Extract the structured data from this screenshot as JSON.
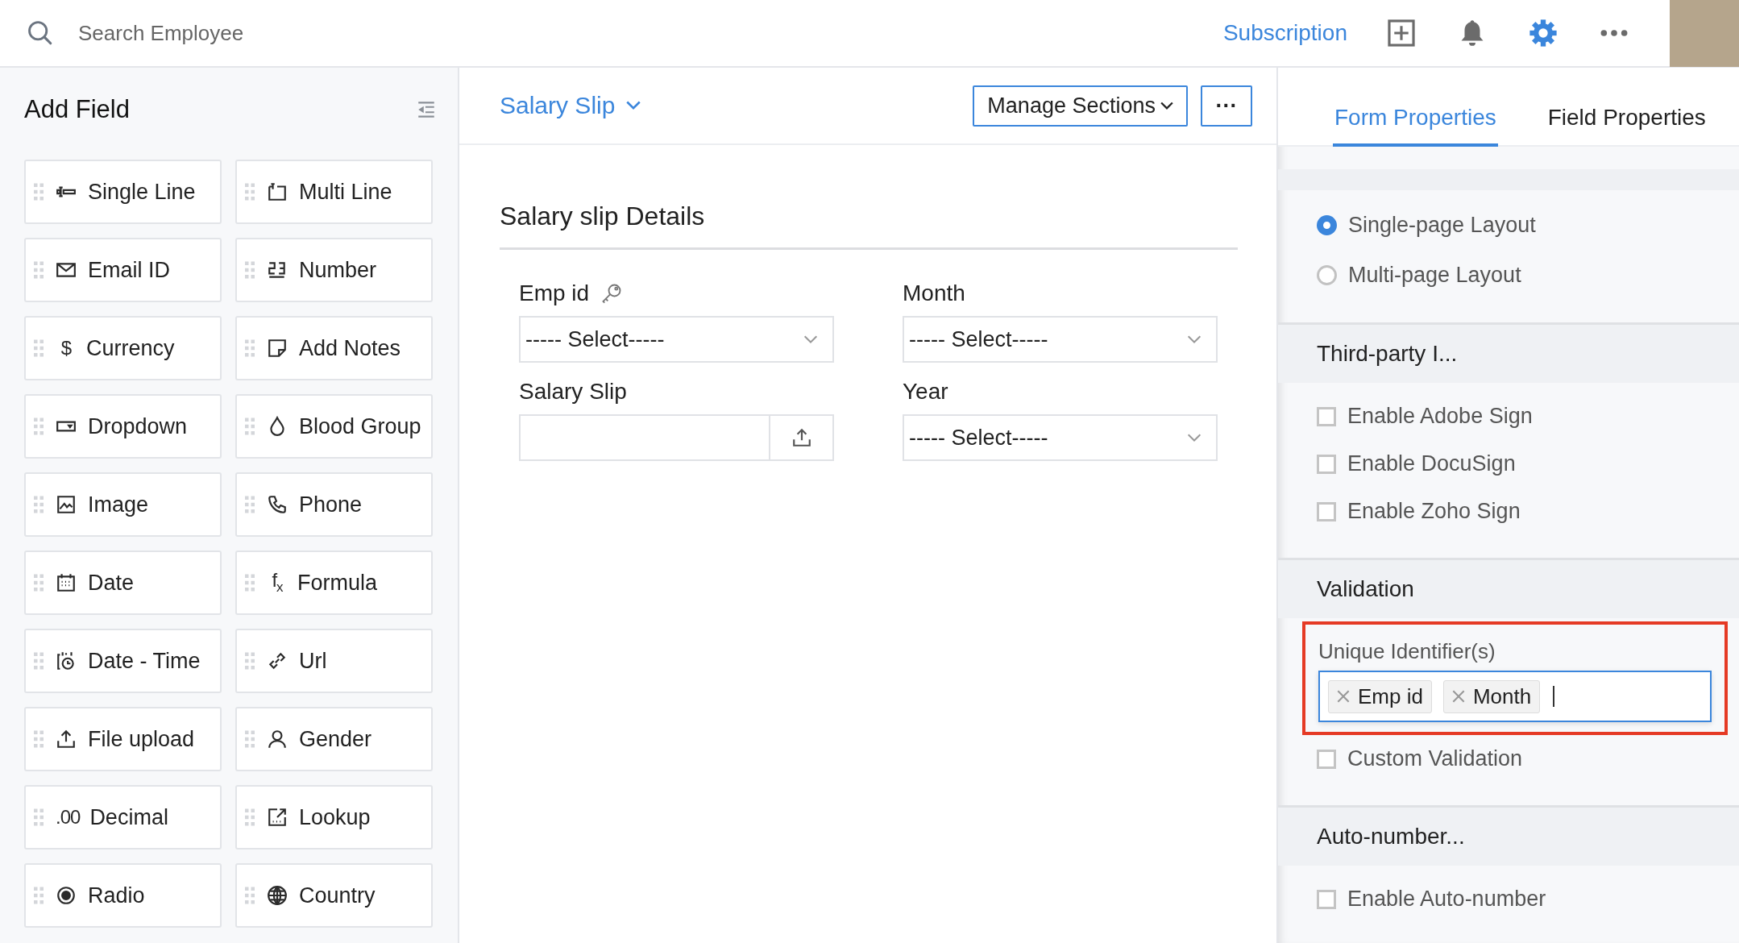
{
  "topbar": {
    "search": {
      "placeholder": "Search Employee"
    },
    "subscription_link": "Subscription"
  },
  "add_field": {
    "title": "Add Field",
    "fields": [
      {
        "label": "Single Line"
      },
      {
        "label": "Multi Line"
      },
      {
        "label": "Email ID"
      },
      {
        "label": "Number"
      },
      {
        "label": "Currency",
        "glyph": "$"
      },
      {
        "label": "Add Notes"
      },
      {
        "label": "Dropdown"
      },
      {
        "label": "Blood Group"
      },
      {
        "label": "Image"
      },
      {
        "label": "Phone"
      },
      {
        "label": "Date"
      },
      {
        "label": "Formula",
        "glyph": "f",
        "glyph_sub": "x"
      },
      {
        "label": "Date - Time"
      },
      {
        "label": "Url"
      },
      {
        "label": "File upload"
      },
      {
        "label": "Gender"
      },
      {
        "label": "Decimal",
        "glyph": ".00"
      },
      {
        "label": "Lookup"
      },
      {
        "label": "Radio"
      },
      {
        "label": "Country"
      }
    ]
  },
  "form": {
    "name": "Salary Slip",
    "manage_sections": "Manage Sections",
    "more": "···",
    "section_title": "Salary slip Details",
    "fields": [
      {
        "label": "Emp id",
        "kind": "select",
        "value": "----- Select-----",
        "key": true
      },
      {
        "label": "Month",
        "kind": "select",
        "value": "----- Select-----",
        "key": false
      },
      {
        "label": "Salary Slip",
        "kind": "upload",
        "key": false
      },
      {
        "label": "Year",
        "kind": "select",
        "value": "----- Select-----",
        "key": false
      }
    ]
  },
  "properties": {
    "tabs": [
      {
        "label": "Form Properties",
        "selected": true
      },
      {
        "label": "Field Properties",
        "selected": false
      }
    ],
    "layouts": [
      {
        "label": "Single-page Layout",
        "selected": true
      },
      {
        "label": "Multi-page Layout",
        "selected": false
      }
    ],
    "third_party": {
      "title": "Third-party I...",
      "options": [
        {
          "label": "Enable Adobe Sign",
          "checked": false
        },
        {
          "label": "Enable DocuSign",
          "checked": false
        },
        {
          "label": "Enable Zoho Sign",
          "checked": false
        }
      ]
    },
    "validation": {
      "title": "Validation",
      "unique_identifiers": {
        "label": "Unique Identifier(s)",
        "highlighted": true,
        "tags": [
          "Emp id",
          "Month"
        ]
      },
      "options": [
        {
          "label": "Custom Validation",
          "checked": false
        }
      ]
    },
    "auto_number": {
      "title": "Auto-number...",
      "options": [
        {
          "label": "Enable Auto-number",
          "checked": false
        }
      ]
    }
  }
}
